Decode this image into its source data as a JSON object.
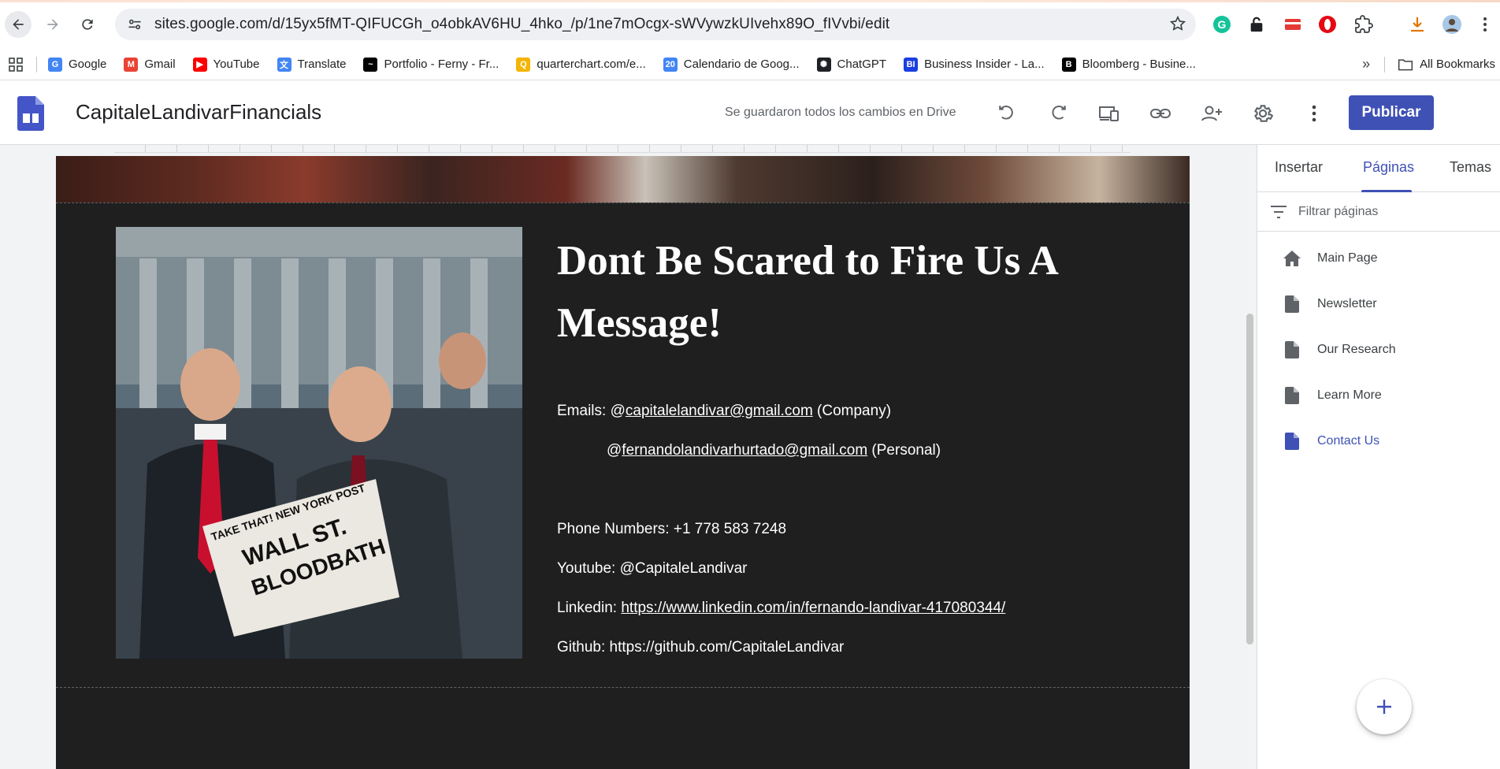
{
  "browser": {
    "url": "sites.google.com/d/15yx5fMT-QIFUCGh_o4obkAV6HU_4hko_/p/1ne7mOcgx-sWVywzkUIvehx89O_fIVvbi/edit",
    "bookmarks": [
      {
        "label": "Google",
        "icon": "google-icon",
        "color": "#4285f4",
        "glyph": "G"
      },
      {
        "label": "Gmail",
        "icon": "gmail-icon",
        "color": "#ea4335",
        "glyph": "M"
      },
      {
        "label": "YouTube",
        "icon": "youtube-icon",
        "color": "#ff0000",
        "glyph": "▶"
      },
      {
        "label": "Translate",
        "icon": "translate-icon",
        "color": "#4285f4",
        "glyph": "文"
      },
      {
        "label": "Portfolio - Ferny - Fr...",
        "icon": "portfolio-icon",
        "color": "#000000",
        "glyph": "~"
      },
      {
        "label": "quarterchart.com/e...",
        "icon": "quarterchart-icon",
        "color": "#f4b400",
        "glyph": "Q"
      },
      {
        "label": "Calendario de Goog...",
        "icon": "calendar-icon",
        "color": "#4285f4",
        "glyph": "20"
      },
      {
        "label": "ChatGPT",
        "icon": "chatgpt-icon",
        "color": "#202124",
        "glyph": "✺"
      },
      {
        "label": "Business Insider - La...",
        "icon": "business-insider-icon",
        "color": "#1a3fe0",
        "glyph": "BI"
      },
      {
        "label": "Bloomberg - Busine...",
        "icon": "bloomberg-icon",
        "color": "#000000",
        "glyph": "B"
      }
    ],
    "all_bookmarks": "All Bookmarks"
  },
  "sites": {
    "site_name": "CapitaleLandivarFinancials",
    "save_status": "Se guardaron todos los cambios en Drive",
    "publish_label": "Publicar"
  },
  "content": {
    "headline": "Dont Be Scared to Fire Us A Message!",
    "emails_label": "Emails: ",
    "email_company_prefix": "@",
    "email_company": "capitalelandivar@gmail.com",
    "email_company_suffix": " (Company)",
    "email_personal_prefix": "@",
    "email_personal": "fernandolandivarhurtado@gmail.com",
    "email_personal_suffix": " (Personal)",
    "phone": "Phone Numbers: +1 778 583 7248",
    "youtube": "Youtube: @CapitaleLandivar",
    "linkedin_label": "Linkedin: ",
    "linkedin_url": "https://www.linkedin.com/in/fernando-landivar-417080344/",
    "github": "Github: https://github.com/CapitaleLandivar"
  },
  "panel": {
    "tabs": [
      "Insertar",
      "Páginas",
      "Temas"
    ],
    "active_tab": "Páginas",
    "filter_placeholder": "Filtrar páginas",
    "pages": [
      {
        "label": "Main Page",
        "icon": "home-icon"
      },
      {
        "label": "Newsletter",
        "icon": "page-icon"
      },
      {
        "label": "Our Research",
        "icon": "page-icon"
      },
      {
        "label": "Learn More",
        "icon": "page-icon"
      },
      {
        "label": "Contact Us",
        "icon": "page-icon",
        "active": true
      }
    ]
  },
  "colors": {
    "accent": "#3f51b5",
    "page_background": "#1f1f1f",
    "canvas_background": "#f1f3f4"
  }
}
